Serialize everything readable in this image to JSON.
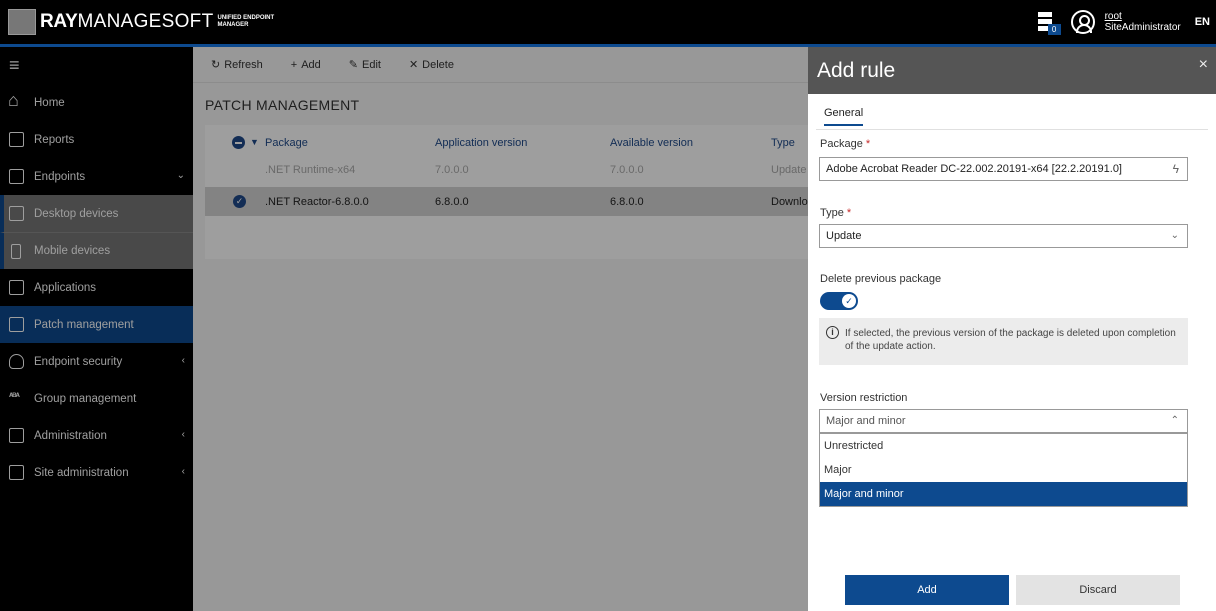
{
  "brand": {
    "ray": "RAY",
    "managesoft": "MANAGESOFT",
    "sub1": "UNIFIED ENDPOINT",
    "sub2": "MANAGER"
  },
  "topbar": {
    "badge_count": "0",
    "user_name": "root",
    "user_role": "SiteAdministrator",
    "language": "EN"
  },
  "sidebar": {
    "items": [
      {
        "label": "Home",
        "icon": "home-icon"
      },
      {
        "label": "Reports",
        "icon": "report-icon"
      },
      {
        "label": "Endpoints",
        "icon": "endpoints-icon",
        "caret": "⌄"
      },
      {
        "label": "Desktop devices",
        "icon": "desktop-icon"
      },
      {
        "label": "Mobile devices",
        "icon": "mobile-icon"
      },
      {
        "label": "Applications",
        "icon": "applications-icon"
      },
      {
        "label": "Patch management",
        "icon": "patch-icon"
      },
      {
        "label": "Endpoint security",
        "icon": "security-icon",
        "caret": "‹"
      },
      {
        "label": "Group management",
        "icon": "group-icon"
      },
      {
        "label": "Administration",
        "icon": "admin-icon",
        "caret": "‹"
      },
      {
        "label": "Site administration",
        "icon": "site-admin-icon",
        "caret": "‹"
      }
    ]
  },
  "toolbar": {
    "refresh": "Refresh",
    "add": "Add",
    "edit": "Edit",
    "delete": "Delete"
  },
  "page": {
    "title": "PATCH MANAGEMENT"
  },
  "table": {
    "columns": [
      "Package",
      "Application version",
      "Available version",
      "Type"
    ],
    "rows": [
      {
        "package": ".NET Runtime-x64",
        "app_version": "7.0.0.0",
        "available_version": "7.0.0.0",
        "type": "Update",
        "selected": false
      },
      {
        "package": ".NET Reactor-6.8.0.0",
        "app_version": "6.8.0.0",
        "available_version": "6.8.0.0",
        "type": "Downloa",
        "selected": true
      }
    ]
  },
  "panel": {
    "title": "Add rule",
    "close": "×",
    "tab_general": "General",
    "package_label": "Package",
    "package_value": "Adobe Acrobat Reader DC-22.002.20191-x64 [22.2.20191.0]",
    "type_label": "Type",
    "type_value": "Update",
    "delete_prev_label": "Delete previous package",
    "delete_prev_on": true,
    "info_text": "If selected, the previous version of the package is deleted upon completion of the update action.",
    "version_label": "Version restriction",
    "version_value": "Major and minor",
    "version_options": [
      "Unrestricted",
      "Major",
      "Major and minor"
    ],
    "add_button": "Add",
    "discard_button": "Discard",
    "required_mark": "*"
  },
  "colors": {
    "accent": "#0d4a8f",
    "topbar": "#000000",
    "panel_header": "#555555"
  }
}
